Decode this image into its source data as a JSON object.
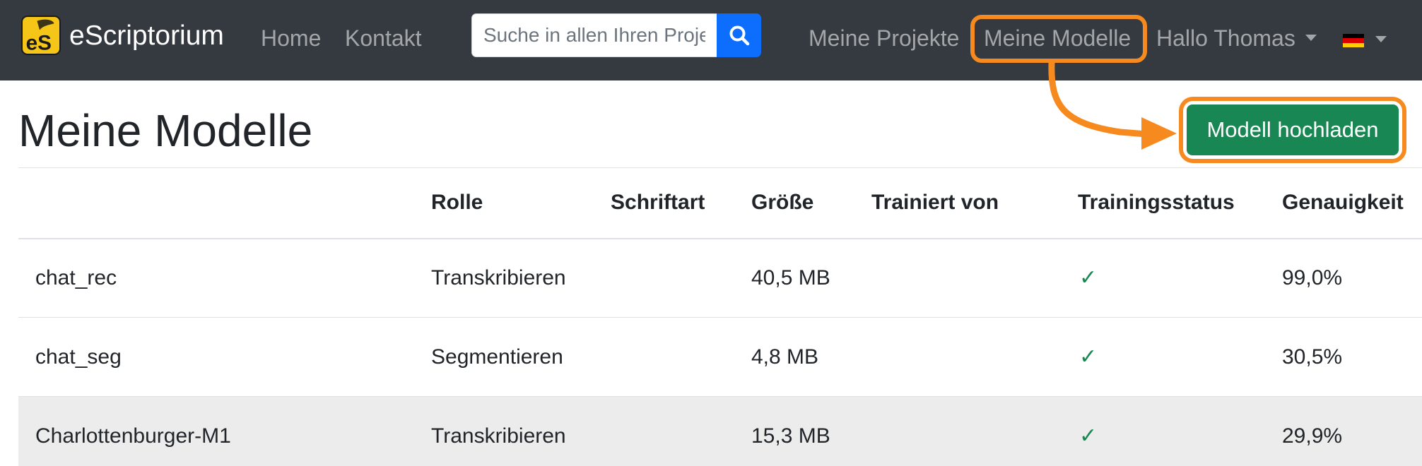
{
  "brand": {
    "name": "eScriptorium",
    "logo_text": "eS",
    "logo_color": "#f5c518"
  },
  "nav": {
    "home": "Home",
    "contact": "Kontakt",
    "search_placeholder": "Suche in allen Ihren Projekten",
    "search_icon": "search-icon",
    "my_projects": "Meine Projekte",
    "my_models": "Meine Modelle",
    "user_greeting": "Hallo Thomas",
    "language_flag": "german-flag-icon"
  },
  "annotation": {
    "color": "#f68a1e",
    "highlighted": "Meine Modelle",
    "arrow_target": "Modell hochladen"
  },
  "page": {
    "title": "Meine Modelle",
    "upload_button": "Modell hochladen",
    "upload_button_color": "#198754"
  },
  "table": {
    "columns": [
      "",
      "Rolle",
      "Schriftart",
      "Größe",
      "Trainiert von",
      "Trainingsstatus",
      "Genauigkeit"
    ],
    "rows": [
      {
        "name": "chat_rec",
        "role": "Transkribieren",
        "script": "",
        "size": "40,5 MB",
        "trained_by": "",
        "status": "✓",
        "accuracy": "99,0%"
      },
      {
        "name": "chat_seg",
        "role": "Segmentieren",
        "script": "",
        "size": "4,8 MB",
        "trained_by": "",
        "status": "✓",
        "accuracy": "30,5%"
      },
      {
        "name": "Charlottenburger-M1",
        "role": "Transkribieren",
        "script": "",
        "size": "15,3 MB",
        "trained_by": "",
        "status": "✓",
        "accuracy": "29,9%"
      }
    ],
    "hovered_row": 2,
    "status_color": "#198754"
  }
}
